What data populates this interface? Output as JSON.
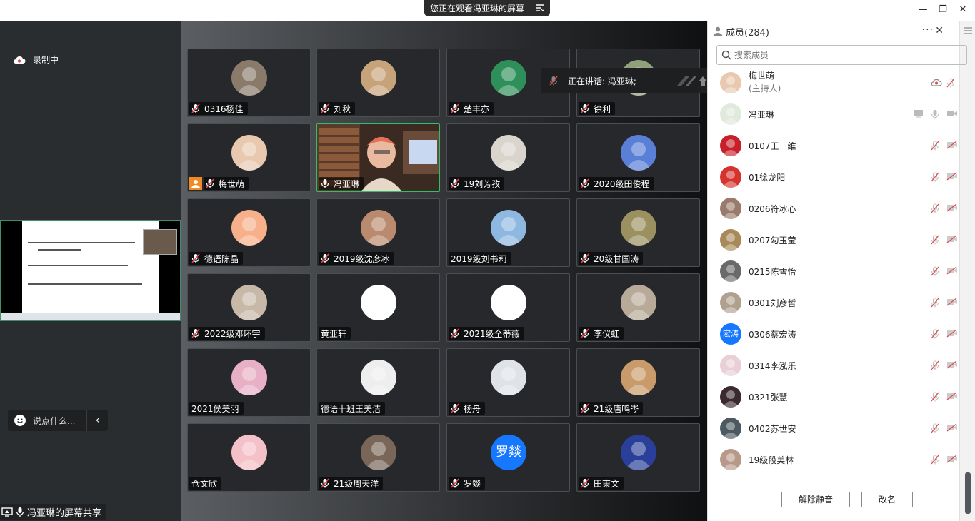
{
  "window": {
    "sharing_banner": "您正在观看冯亚琳的屏幕",
    "minimize": "—",
    "restore": "❐",
    "close": "✕"
  },
  "left_panel": {
    "recording_label": "录制中",
    "chat_placeholder": "说点什么...",
    "collapse_arrow": "‹",
    "share_label": "冯亚琳的屏幕共享"
  },
  "speaking_popup": {
    "text": "正在讲话: 冯亚琳;"
  },
  "tiles": [
    {
      "name": "0316杨佳",
      "muted": true,
      "color": "#8a7a6a"
    },
    {
      "name": "刘秋",
      "muted": true,
      "color": "#c7a37a"
    },
    {
      "name": "楚丰亦",
      "muted": true,
      "color": "#2f8f5a"
    },
    {
      "name": "徐利",
      "muted": true,
      "color": "#8fa07a"
    },
    {
      "name": "梅世萌",
      "muted": true,
      "color": "#e8c9b0",
      "host": true
    },
    {
      "name": "冯亚琳",
      "muted": false,
      "active": true
    },
    {
      "name": "19刘芳孜",
      "muted": true,
      "color": "#d9d4cc"
    },
    {
      "name": "2020级田俊程",
      "muted": true,
      "color": "#5a7fd6"
    },
    {
      "name": "德语陈晶",
      "muted": true,
      "color": "#f7b08a"
    },
    {
      "name": "2019级沈彦冰",
      "muted": true,
      "color": "#b98a6e"
    },
    {
      "name": "2019级刘书莉",
      "muted": false,
      "nomic": true,
      "color": "#8fb8e0"
    },
    {
      "name": "20级甘国涛",
      "muted": true,
      "color": "#9a9060"
    },
    {
      "name": "2022级邓环宇",
      "muted": true,
      "color": "#c8b8a8"
    },
    {
      "name": "黄亚轩",
      "muted": false,
      "nomic": true,
      "color": "#ffffff"
    },
    {
      "name": "2021级全蒂薇",
      "muted": true,
      "color": "#ffffff"
    },
    {
      "name": "李仪虹",
      "muted": true,
      "color": "#b8aa98"
    },
    {
      "name": "2021侯美羽",
      "muted": false,
      "nomic": true,
      "color": "#e7b0c4"
    },
    {
      "name": "德语十班王美洁",
      "muted": false,
      "nomic": true,
      "color": "#eeeeee"
    },
    {
      "name": "杨舟",
      "muted": true,
      "color": "#dfe3e8"
    },
    {
      "name": "21级唐鸣岑",
      "muted": true,
      "color": "#c99a6a"
    },
    {
      "name": "仓文欣",
      "muted": false,
      "nomic": true,
      "color": "#f4c1c8"
    },
    {
      "name": "21级周天洋",
      "muted": true,
      "color": "#7a6658"
    },
    {
      "name": "罗燚",
      "muted": true,
      "text_avatar": "罗燚",
      "color": "#1677ff"
    },
    {
      "name": "田東文",
      "muted": true,
      "color": "#2a3f9a"
    }
  ],
  "members_panel": {
    "title": "成员(284)",
    "more": "···",
    "close": "✕",
    "search_placeholder": "搜索成员",
    "members": [
      {
        "name": "梅世萌",
        "role": "(主持人)",
        "color": "#e8c9b0"
      },
      {
        "name": "冯亚琳",
        "color": "#dfe9dc"
      },
      {
        "name": "0107王一维",
        "color": "#c8202a"
      },
      {
        "name": "01徐龙阳",
        "color": "#d6332f"
      },
      {
        "name": "0206符冰心",
        "color": "#9a7a6a"
      },
      {
        "name": "0207勾玉莹",
        "color": "#a88a5a"
      },
      {
        "name": "0215陈雪怡",
        "color": "#6a6a6a"
      },
      {
        "name": "0301刘彦哲",
        "color": "#b0a090"
      },
      {
        "name": "0306蔡宏涛",
        "text_avatar": "宏涛",
        "color": "#1677ff"
      },
      {
        "name": "0314李泓乐",
        "color": "#e8d0d6"
      },
      {
        "name": "0321张慧",
        "color": "#3a2a30"
      },
      {
        "name": "0402苏世安",
        "color": "#4a5a60"
      },
      {
        "name": "19级段美林",
        "color": "#b89888"
      }
    ],
    "unmute_all": "解除静音",
    "rename": "改名"
  },
  "colors": {
    "muted_red": "#e5484d",
    "active_green": "#2fbe6b",
    "host_orange": "#f08a24"
  }
}
